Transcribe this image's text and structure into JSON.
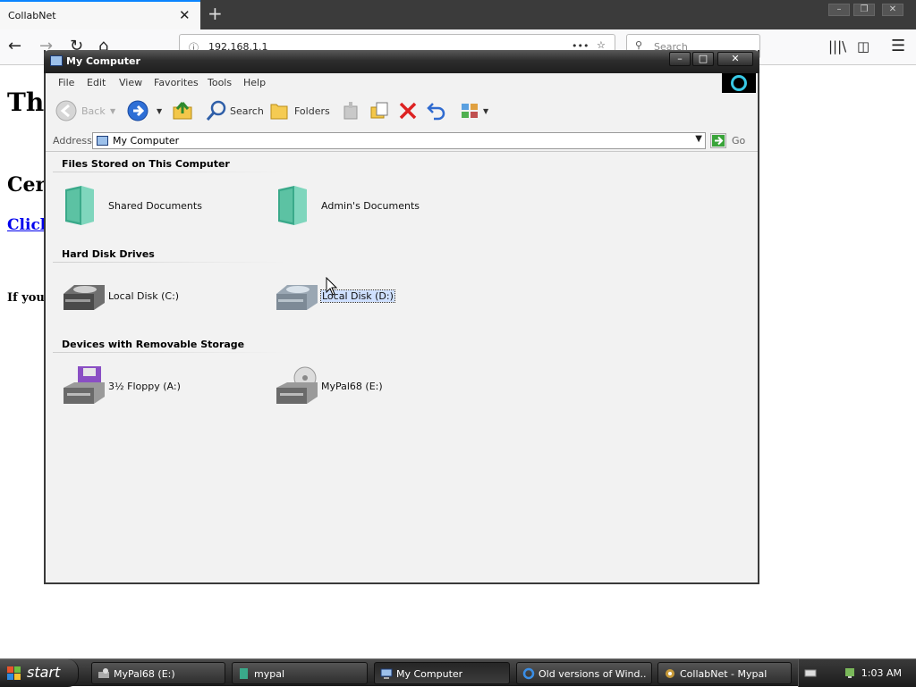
{
  "browser": {
    "tab_title": "CollabNet",
    "url": "192.168.1.1",
    "search_placeholder": "Search",
    "page_fragments": [
      "Thi",
      "Cer",
      "Click",
      "If you"
    ]
  },
  "window": {
    "title": "My Computer",
    "menu": [
      "File",
      "Edit",
      "View",
      "Favorites",
      "Tools",
      "Help"
    ],
    "toolbar": {
      "back": "Back",
      "search": "Search",
      "folders": "Folders"
    },
    "address_label": "Address",
    "address_value": "My Computer",
    "go": "Go",
    "groups": [
      {
        "header": "Files Stored on This Computer",
        "items": [
          {
            "label": "Shared Documents",
            "icon": "folder-icon"
          },
          {
            "label": "Admin's Documents",
            "icon": "folder-icon"
          }
        ]
      },
      {
        "header": "Hard Disk Drives",
        "items": [
          {
            "label": "Local Disk (C:)",
            "icon": "hard-disk-icon"
          },
          {
            "label": "Local Disk (D:)",
            "icon": "hard-disk-icon",
            "selected": true
          }
        ]
      },
      {
        "header": "Devices with Removable Storage",
        "items": [
          {
            "label": "3½ Floppy (A:)",
            "icon": "floppy-drive-icon"
          },
          {
            "label": "MyPal68 (E:)",
            "icon": "cd-drive-icon"
          }
        ]
      }
    ]
  },
  "taskbar": {
    "start": "start",
    "buttons": [
      {
        "label": "MyPal68 (E:)",
        "icon": "drive-icon"
      },
      {
        "label": "mypal",
        "icon": "folder-icon"
      },
      {
        "label": "My Computer",
        "icon": "computer-icon",
        "active": true
      },
      {
        "label": "Old versions of Wind...",
        "icon": "ie-icon"
      },
      {
        "label": "CollabNet - Mypal",
        "icon": "browser-icon"
      }
    ],
    "clock": "1:03 AM"
  },
  "colors": {
    "selection": "#cfe0ff",
    "title_bar": "#2d2d2d",
    "window_bg": "#f2f2f2"
  }
}
